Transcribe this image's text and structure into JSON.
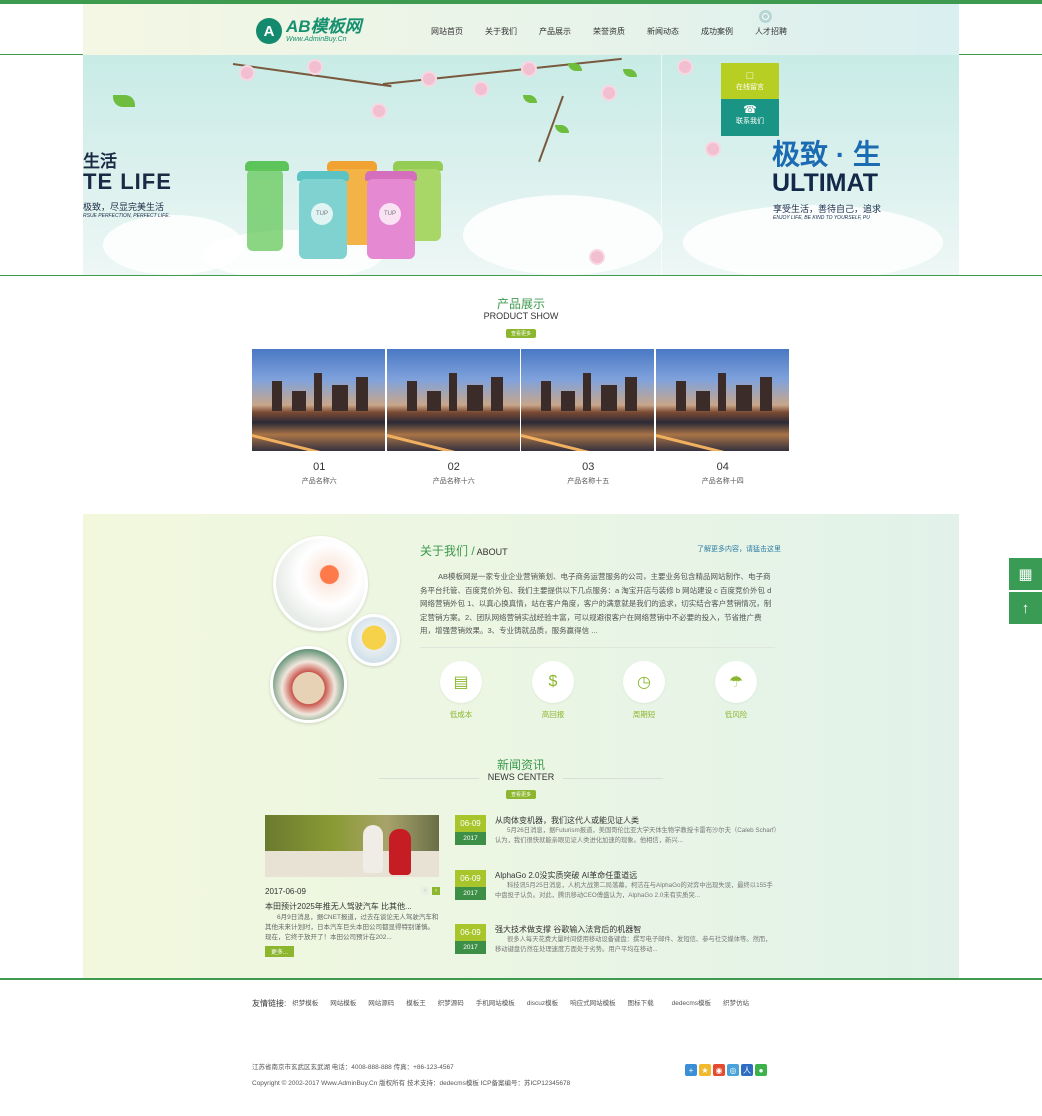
{
  "header": {
    "logo_mark": "A",
    "logo_name": "AB模板网",
    "logo_url": "Www.AdminBuy.Cn",
    "nav": [
      "网站首页",
      "关于我们",
      "产品展示",
      "荣誉资质",
      "新闻动态",
      "成功案例",
      "人才招聘"
    ]
  },
  "banner": {
    "left_cn": "生活",
    "left_en": "TE  LIFE",
    "left_sub": "极致，尽显完美生活",
    "left_tiny": "RSUE PERFECTION, PERFECT LIFE.",
    "right_cn": "极致 · 生",
    "right_en": "ULTIMAT",
    "right_sub": "享受生活，善待自己，追求",
    "right_tiny": "ENJOY LIFE, BE KIND TO YOURSELF, PU",
    "cup_label": "TUP"
  },
  "side_widget": {
    "message_label": "在线留言",
    "contact_label": "联系我们"
  },
  "products_section": {
    "title_cn": "产品展示",
    "title_en": "PRODUCT SHOW",
    "more": "查看更多",
    "items": [
      {
        "num": "01",
        "name": "产品名称六"
      },
      {
        "num": "02",
        "name": "产品名称十六"
      },
      {
        "num": "03",
        "name": "产品名称十五"
      },
      {
        "num": "04",
        "name": "产品名称十四"
      }
    ]
  },
  "about": {
    "title_cn": "关于我们 /",
    "title_en": "ABOUT",
    "more": "了解更多内容，请猛击这里",
    "text": "AB模板网是一家专业企业营销策划、电子商务运营服务的公司，主要业务包含精品网站制作、电子商务平台托管、百度竞价外包、我们主要提供以下几点服务：a 淘宝开店与装修 b 网站建设 c 百度竞价外包 d 网络营销外包 1、以真心换真情，站在客户角度，客户的满意就是我们的追求，切实结合客户营销情况，制定营销方案。2、团队网络营销实战经验丰富，可以规避很客户在网络营销中不必要的投入，节省推广费用，增强营销效果。3、专业铸就品质，服务赢得信 ...",
    "features": [
      "低成本",
      "高回报",
      "周期短",
      "低风险"
    ]
  },
  "news_section": {
    "title_cn": "新闻资讯",
    "title_en": "NEWS CENTER",
    "more": "查看更多",
    "featured": {
      "date": "2017-06-09",
      "title": "本田预计2025年推无人驾驶汽车 比其他...",
      "desc": "6月9日消息，据CNET报道，过去在谈论无人驾驶汽车和其他未来计划时，日本汽车巨头本田公司都显得特别谨慎。现在，它终于放开了！本田公司预计在202...",
      "more": "更多..."
    },
    "items": [
      {
        "day": "06-09",
        "year": "2017",
        "title": "从肉体变机器，我们这代人或能见证人类",
        "desc": "5月26日消息，据Futurism报道，美国哥伦比亚大学天体生物学教授卡雷布沙尔夫（Caleb Scharf）认为，我们很快就能亲眼见证人类进化加速的现象。他相信，新兴..."
      },
      {
        "day": "06-09",
        "year": "2017",
        "title": "AlphaGo 2.0没实质突破 AI革命任重道远",
        "desc": "科技讯5月25日消息，人机大战第二局落幕，柯洁在与AlphaGo的对弈中出现失误，最终以155手中盘投子认负。对此，腾讯移动CEO傅盛认为，AlphaGo 2.0未有实质突..."
      },
      {
        "day": "06-09",
        "year": "2017",
        "title": "强大技术做支撑 谷歌输入法背后的机器智",
        "desc": "很多人每天花费大量时间使用移动设备键盘：撰写电子邮件、发短信、参与社交媒体等。然而，移动键盘仍然在处理速度方面处于劣势。用户平均在移动..."
      }
    ]
  },
  "footer": {
    "links_label": "友情链接:",
    "links": [
      "织梦模板",
      "网站模板",
      "网站源码",
      "模板王",
      "织梦源码",
      "手机网站模板",
      "discuz模板",
      "响应式网站模板",
      "图标下载",
      "dedecms模板",
      "织梦仿站"
    ],
    "address": "江苏省南京市玄武区玄武湖   电话：4008-888-888   传真：+86-123-4567",
    "copyright": "Copyright © 2002-2017 Www.AdminBuy.Cn 版权所有   技术支持：dedecms模板   ICP备案编号：苏ICP12345678",
    "share_icons": [
      "share-plus-icon",
      "qzone-icon",
      "weibo-icon",
      "tencent-weibo-icon",
      "renren-icon",
      "wechat-icon"
    ]
  },
  "colors": {
    "brand_green": "#3d9a4e",
    "accent_lime": "#8bb62d",
    "teal": "#1a9484"
  }
}
